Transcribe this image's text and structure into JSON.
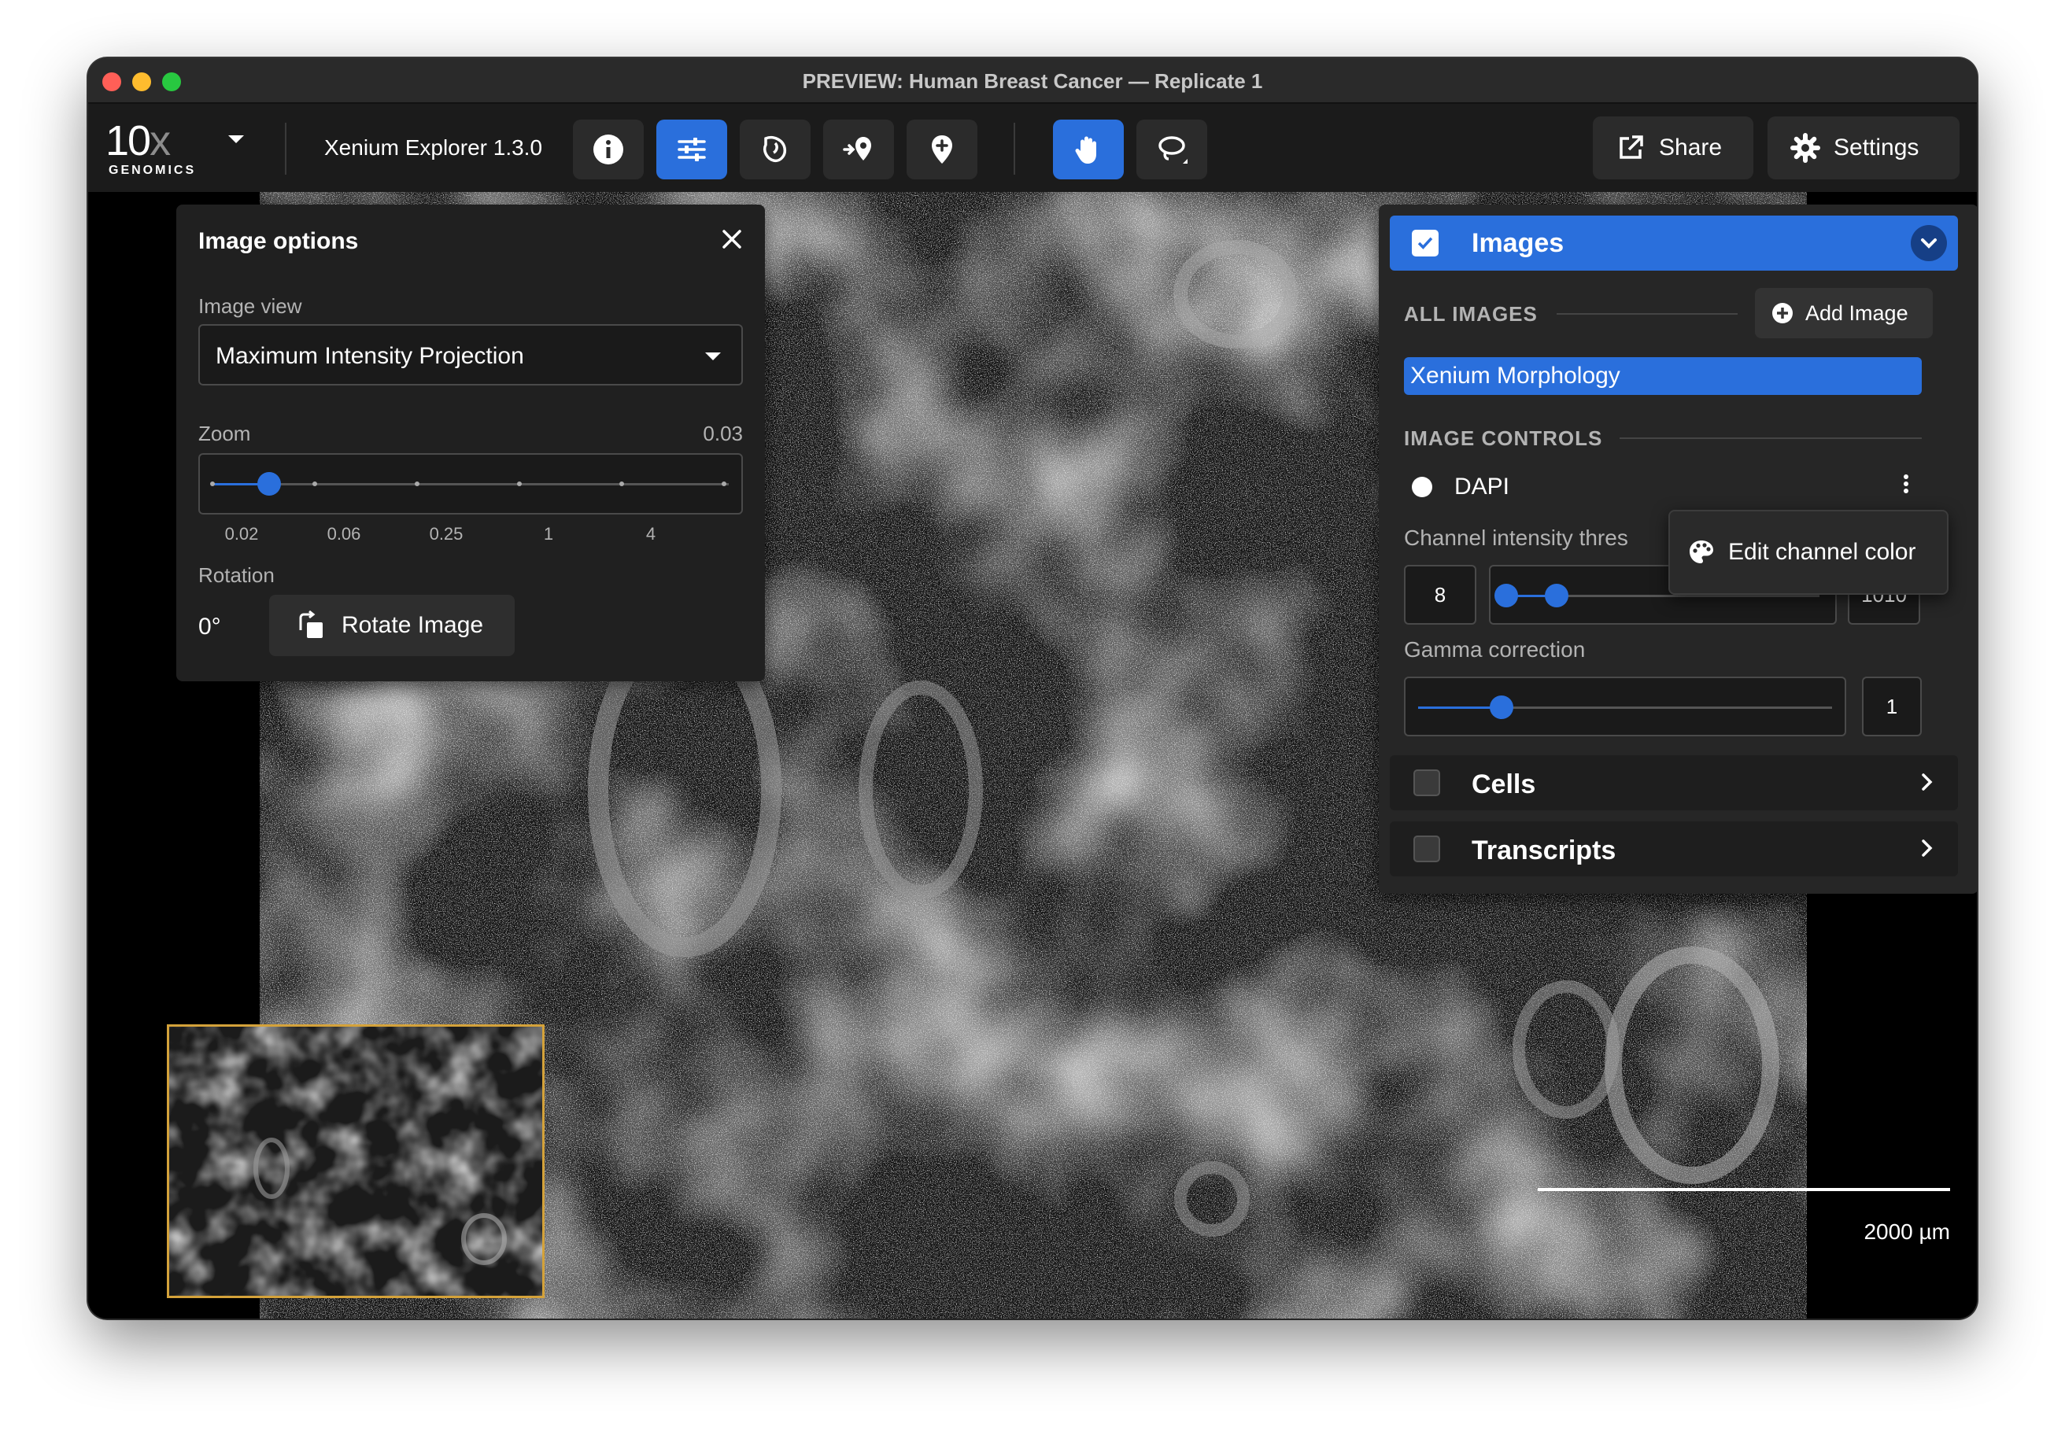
{
  "window": {
    "title": "PREVIEW: Human Breast Cancer — Replicate 1"
  },
  "toolbar": {
    "logo_main": "10",
    "logo_x": "x",
    "logo_sub": "GENOMICS",
    "app_version": "Xenium Explorer 1.3.0",
    "buttons": [
      {
        "icon": "info-icon"
      },
      {
        "icon": "sliders-icon",
        "active": true
      },
      {
        "icon": "cell-segmentation-icon"
      },
      {
        "icon": "add-location-icon"
      },
      {
        "icon": "pin-add-icon"
      },
      {
        "icon": "hand-pan-icon",
        "active": true
      },
      {
        "icon": "lasso-icon"
      }
    ],
    "share_label": "Share",
    "settings_label": "Settings",
    "accent_color": "#2a6fdc"
  },
  "image_options": {
    "title": "Image options",
    "image_view_label": "Image view",
    "image_view_value": "Maximum Intensity Projection",
    "zoom_label": "Zoom",
    "zoom_value": "0.03",
    "zoom_ticks": [
      "0.02",
      "0.06",
      "0.25",
      "1",
      "4"
    ],
    "rotation_label": "Rotation",
    "rotation_value": "0°",
    "rotate_button": "Rotate Image"
  },
  "layers": {
    "images_title": "Images",
    "all_images_label": "ALL IMAGES",
    "add_image_label": "Add Image",
    "selected_image": "Xenium Morphology",
    "image_controls_label": "IMAGE CONTROLS",
    "channel_name": "DAPI",
    "channel_intensity_label": "Channel intensity thres",
    "intensity_min": "8",
    "intensity_max": "1010",
    "gamma_label": "Gamma correction",
    "gamma_value": "1",
    "cells_title": "Cells",
    "transcripts_title": "Transcripts"
  },
  "popover": {
    "edit_channel_color": "Edit channel color"
  },
  "scalebar": {
    "label": "2000 µm"
  }
}
